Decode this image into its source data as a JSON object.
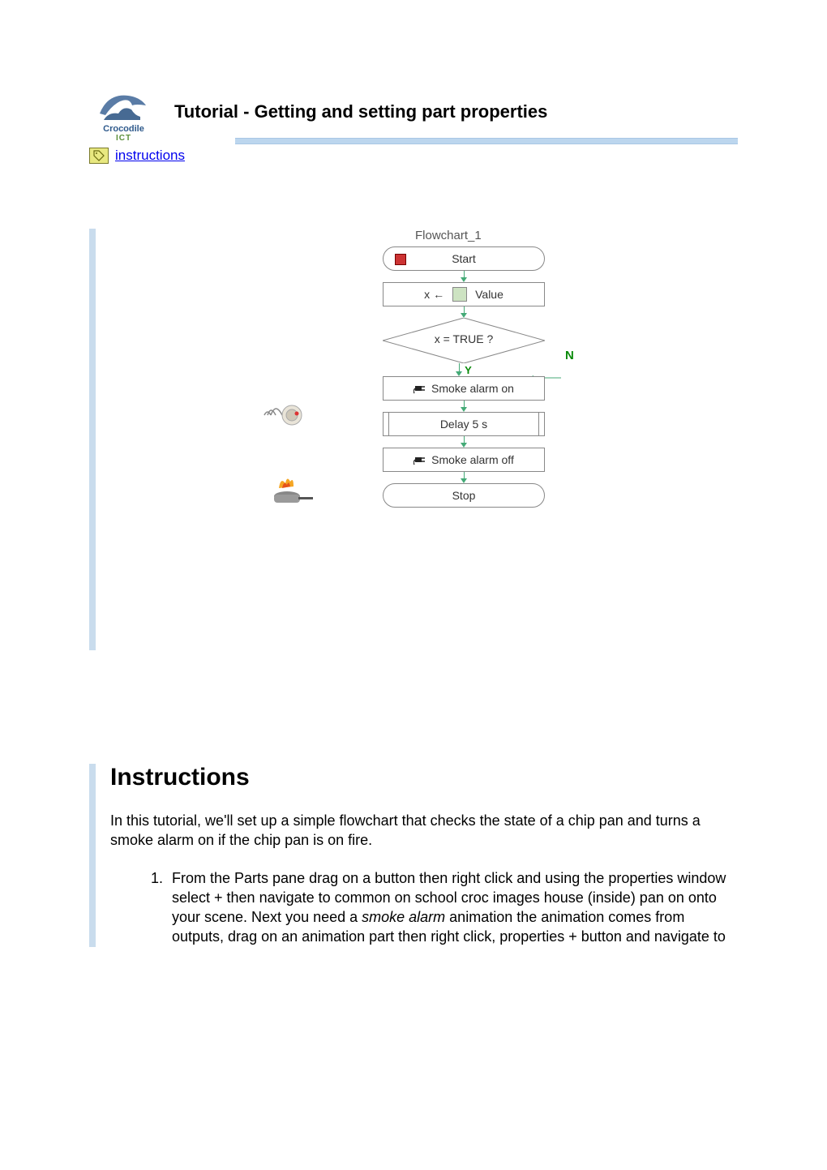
{
  "header": {
    "logo_line1": "Crocodile",
    "logo_line2": "ICT",
    "title": "Tutorial - Getting and setting part properties",
    "instructions_link": "instructions"
  },
  "flowchart": {
    "title": "Flowchart_1",
    "start": "Start",
    "assign_var": "x",
    "assign_arrow": "←",
    "assign_value_label": "Value",
    "decision": "x  =  TRUE  ?",
    "n": "N",
    "y": "Y",
    "smoke_on": "Smoke alarm on",
    "delay": "Delay  5  s",
    "smoke_off": "Smoke alarm off",
    "stop": "Stop"
  },
  "instructions": {
    "heading": "Instructions",
    "intro": "In this tutorial, we'll set up a simple flowchart that checks the state of a chip pan and turns a smoke alarm on if the chip pan is on fire.",
    "step1_a": "From the Parts pane drag on a button then right click and using  the properties window select + then navigate to common on school croc images  house (inside) pan on onto your scene. Next you need a ",
    "step1_italic": "smoke alarm",
    "step1_b": " animation the animation comes from outputs, drag on an animation part then right click, properties + button and navigate to"
  }
}
